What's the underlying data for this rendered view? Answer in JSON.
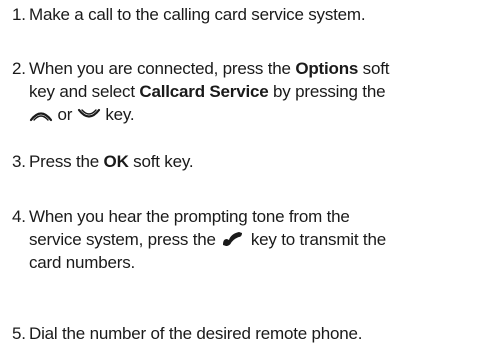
{
  "steps": [
    {
      "number": "1.",
      "text": "Make a call to the calling card service system."
    },
    {
      "number": "2.",
      "line1_prefix": "When you are connected, press the ",
      "options_label": "Options",
      "line1_suffix": " soft",
      "line2_prefix": "key and select ",
      "callcard_label": "Callcard Service",
      "line2_suffix": " by pressing the",
      "line3_or": "or",
      "line3_suffix": "key.",
      "icons": [
        "up-arrow-key-icon",
        "down-arrow-key-icon"
      ]
    },
    {
      "number": "3.",
      "prefix": "Press the ",
      "ok_label": "OK",
      "suffix": " soft key."
    },
    {
      "number": "4.",
      "line1": "When you hear the prompting tone from the",
      "line2_prefix": "service system, press the",
      "line2_suffix": "key to transmit the",
      "line3": "card numbers.",
      "icons": [
        "send-key-icon"
      ]
    },
    {
      "number": "5.",
      "text": "Dial the number of the desired remote phone."
    }
  ],
  "colors": {
    "text": "#1a1a1a"
  }
}
